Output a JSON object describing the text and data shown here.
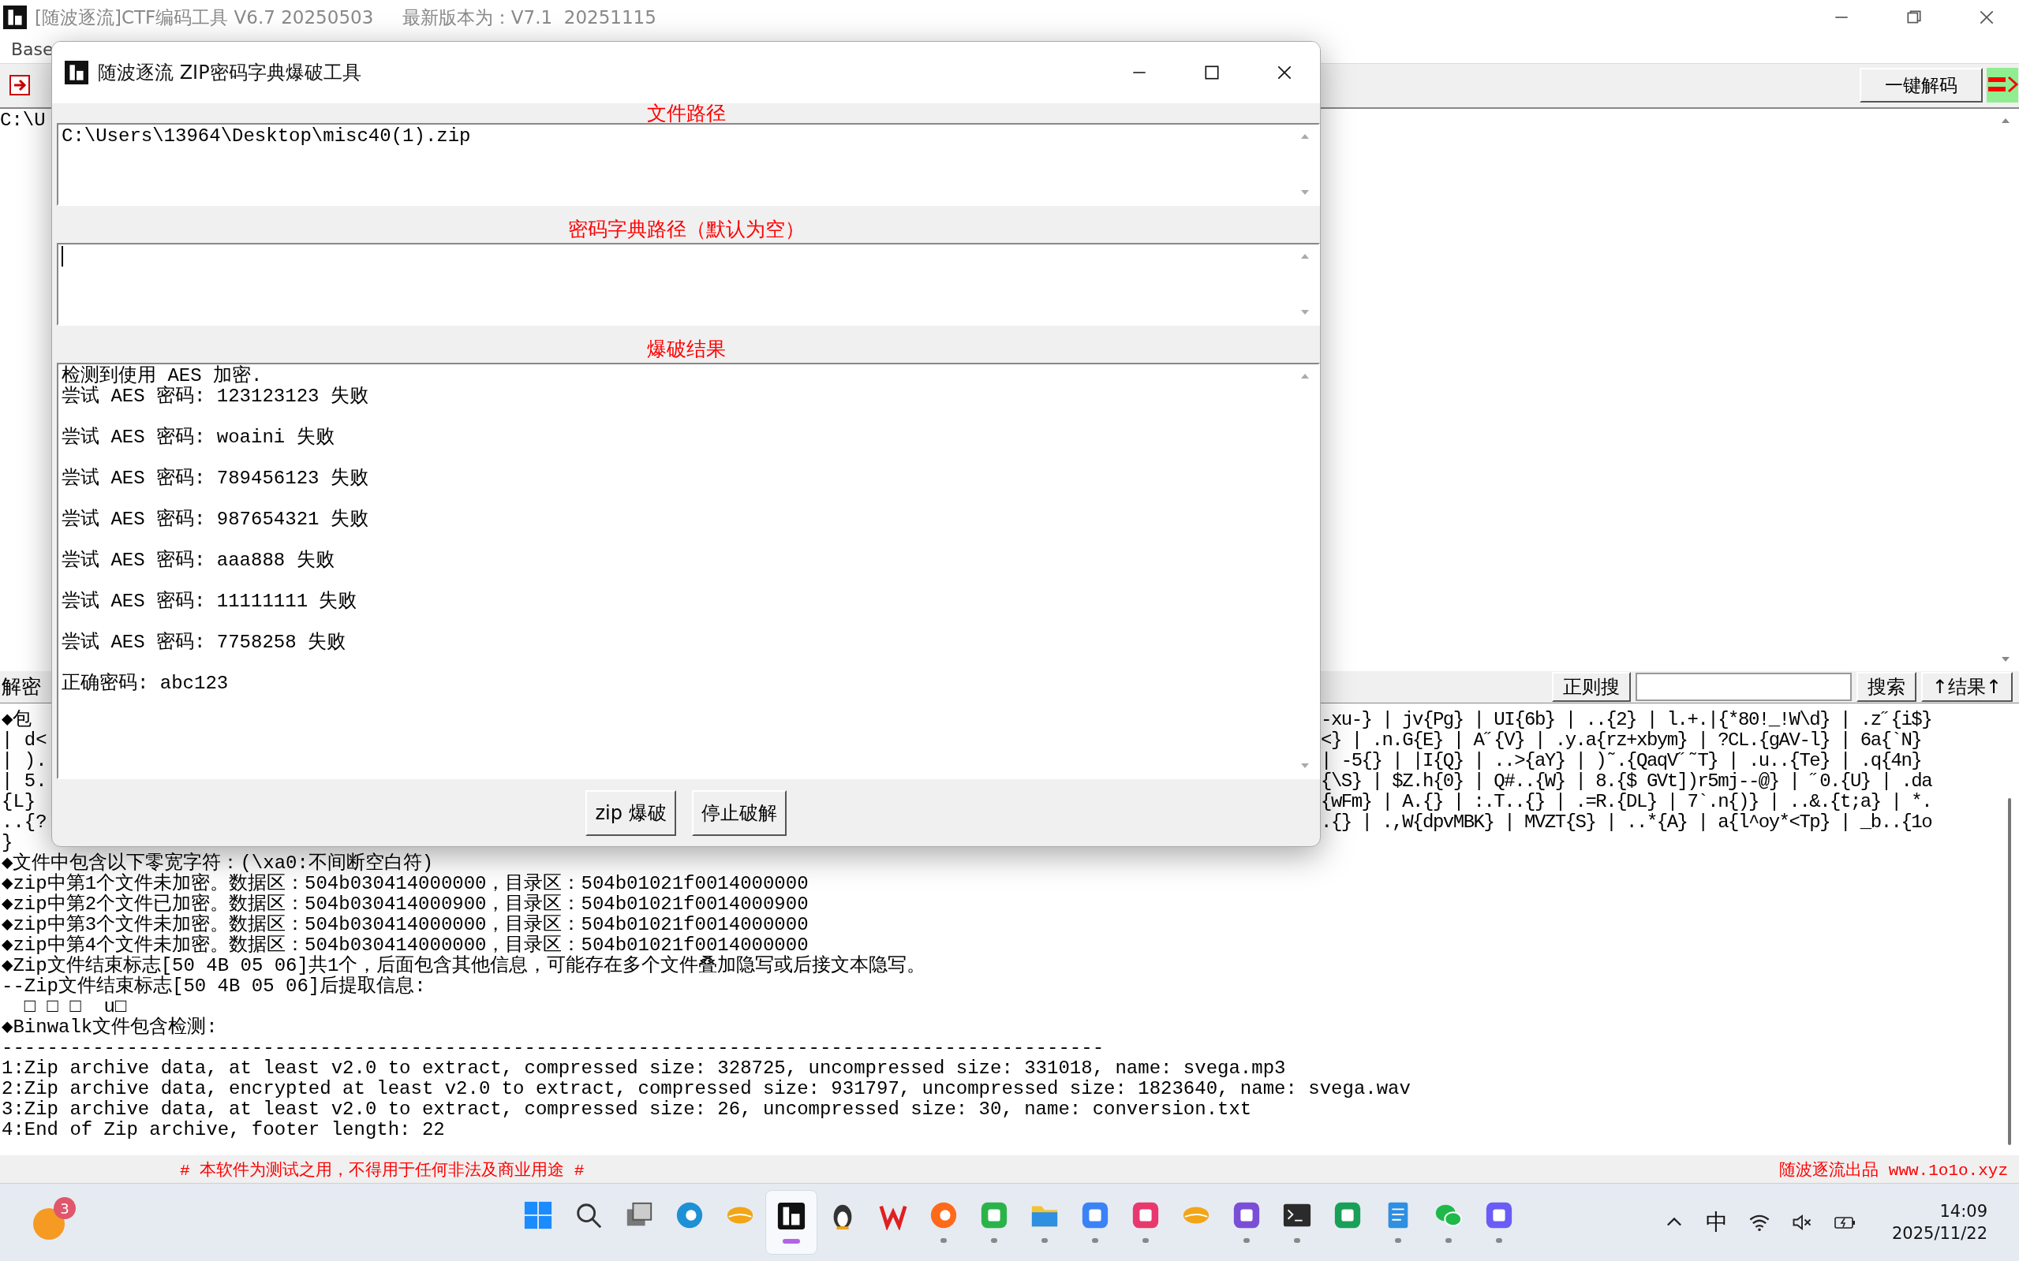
{
  "app_window": {
    "title": "[随波逐流]CTF编码工具 V6.7 20250503     最新版本为：V7.1  20251115",
    "menu": [
      "Base"
    ],
    "path_fragment": "C:\\U",
    "toolbar": {
      "decode_button": "一键解码"
    },
    "search_bar": {
      "label": "解密",
      "regex_button": "正则搜",
      "search_button": "搜索",
      "results_button": "↑结果↑"
    },
    "output_rows": [
      {
        "left": "◆包",
        "right": "-xu-} | jv{Pg} | UI{6b} | ..{2} | l.+.|{*80!_!W\\d} | .z˝{i$}"
      },
      {
        "left": "| d<",
        "right": "<} | .n.G{E} | A˝{V} | .y.a{rz+xbym} | ?CL.{gAV-l} | 6a{`N}"
      },
      {
        "left": "| ).",
        "right": "| -5{} | |I{Q} | ..>{aY} | )˜.{QaqV˝˜T} | .u..{Te} | .q{4n}"
      },
      {
        "left": "| 5.",
        "right": "{\\S} | $Z.h{0} | Q#..{W} | 8.{$ GVt])r5mj--@} | ˝0.{U} | .da"
      },
      {
        "left": "{L}",
        "right": "{wFm} | A.{} | :.T..{} | .=R.{DL} | 7`.n{)} | ..&.{t;a} | *."
      },
      {
        "left": "..{?",
        "right": ".{} | .,W{dpvMBK} | MVZT{S} | ..*{A} | a{l^oy*<Tp} | _b..{1o"
      }
    ],
    "output_lines": [
      "}",
      "◆文件中包含以下零宽字符：(\\xa0:不间断空白符)",
      "◆zip中第1个文件未加密。数据区：504b030414000000，目录区：504b01021f0014000000",
      "◆zip中第2个文件已加密。数据区：504b030414000900，目录区：504b01021f0014000900",
      "◆zip中第3个文件未加密。数据区：504b030414000000，目录区：504b01021f0014000000",
      "◆zip中第4个文件未加密。数据区：504b030414000000，目录区：504b01021f0014000000",
      "◆Zip文件结束标志[50 4B 05 06]共1个，后面包含其他信息，可能存在多个文件叠加隐写或后接文本隐写。",
      "--Zip文件结束标志[50 4B 05 06]后提取信息:",
      "  □ □ □  u□",
      "◆Binwalk文件包含检测:",
      "-------------------------------------------------------------------------------------------------",
      "1:Zip archive data, at least v2.0 to extract, compressed size: 328725, uncompressed size: 331018, name: svega.mp3",
      "2:Zip archive data, encrypted at least v2.0 to extract, compressed size: 931797, uncompressed size: 1823640, name: svega.wav",
      "3:Zip archive data, at least v2.0 to extract, compressed size: 26, uncompressed size: 30, name: conversion.txt",
      "4:End of Zip archive, footer length: 22"
    ],
    "footer": {
      "notice": "# 本软件为测试之用，不得用于任何非法及商业用途 #",
      "credit": "随波逐流出品 www.1o1o.xyz"
    }
  },
  "dialog": {
    "title": "随波逐流 ZIP密码字典爆破工具",
    "fields": [
      {
        "label": "文件路径",
        "value": "C:\\Users\\13964\\Desktop\\misc40(1).zip",
        "focused": false
      },
      {
        "label": "密码字典路径（默认为空）",
        "focused": true
      }
    ],
    "results_label": "爆破结果",
    "results": [
      "检测到使用 AES 加密.",
      "尝试 AES 密码: 123123123 失败",
      "尝试 AES 密码: woaini 失败",
      "尝试 AES 密码: 789456123 失败",
      "尝试 AES 密码: 987654321 失败",
      "尝试 AES 密码: aaa888 失败",
      "尝试 AES 密码: 11111111 失败",
      "尝试 AES 密码: 7758258 失败",
      "正确密码: abc123"
    ],
    "buttons": [
      "zip 爆破",
      "停止破解"
    ]
  },
  "taskbar": {
    "weather_badge": "3",
    "apps": [
      {
        "running": false,
        "selected": false
      },
      {
        "running": false,
        "selected": false
      },
      {
        "running": false,
        "selected": false
      },
      {
        "running": false,
        "selected": false
      },
      {
        "running": false,
        "selected": false
      },
      {
        "running": true,
        "selected": true
      },
      {
        "running": false,
        "selected": false
      },
      {
        "running": false,
        "selected": false
      },
      {
        "running": true,
        "selected": false
      },
      {
        "running": true,
        "selected": false
      },
      {
        "running": true,
        "selected": false
      },
      {
        "running": true,
        "selected": false
      },
      {
        "running": true,
        "selected": false
      },
      {
        "running": false,
        "selected": false
      },
      {
        "running": true,
        "selected": false
      },
      {
        "running": true,
        "selected": false
      },
      {
        "running": false,
        "selected": false
      },
      {
        "running": true,
        "selected": false
      },
      {
        "running": true,
        "selected": false
      },
      {
        "running": true,
        "selected": false
      }
    ],
    "ime": "中",
    "time": "14:09",
    "date": "2025/11/22"
  }
}
